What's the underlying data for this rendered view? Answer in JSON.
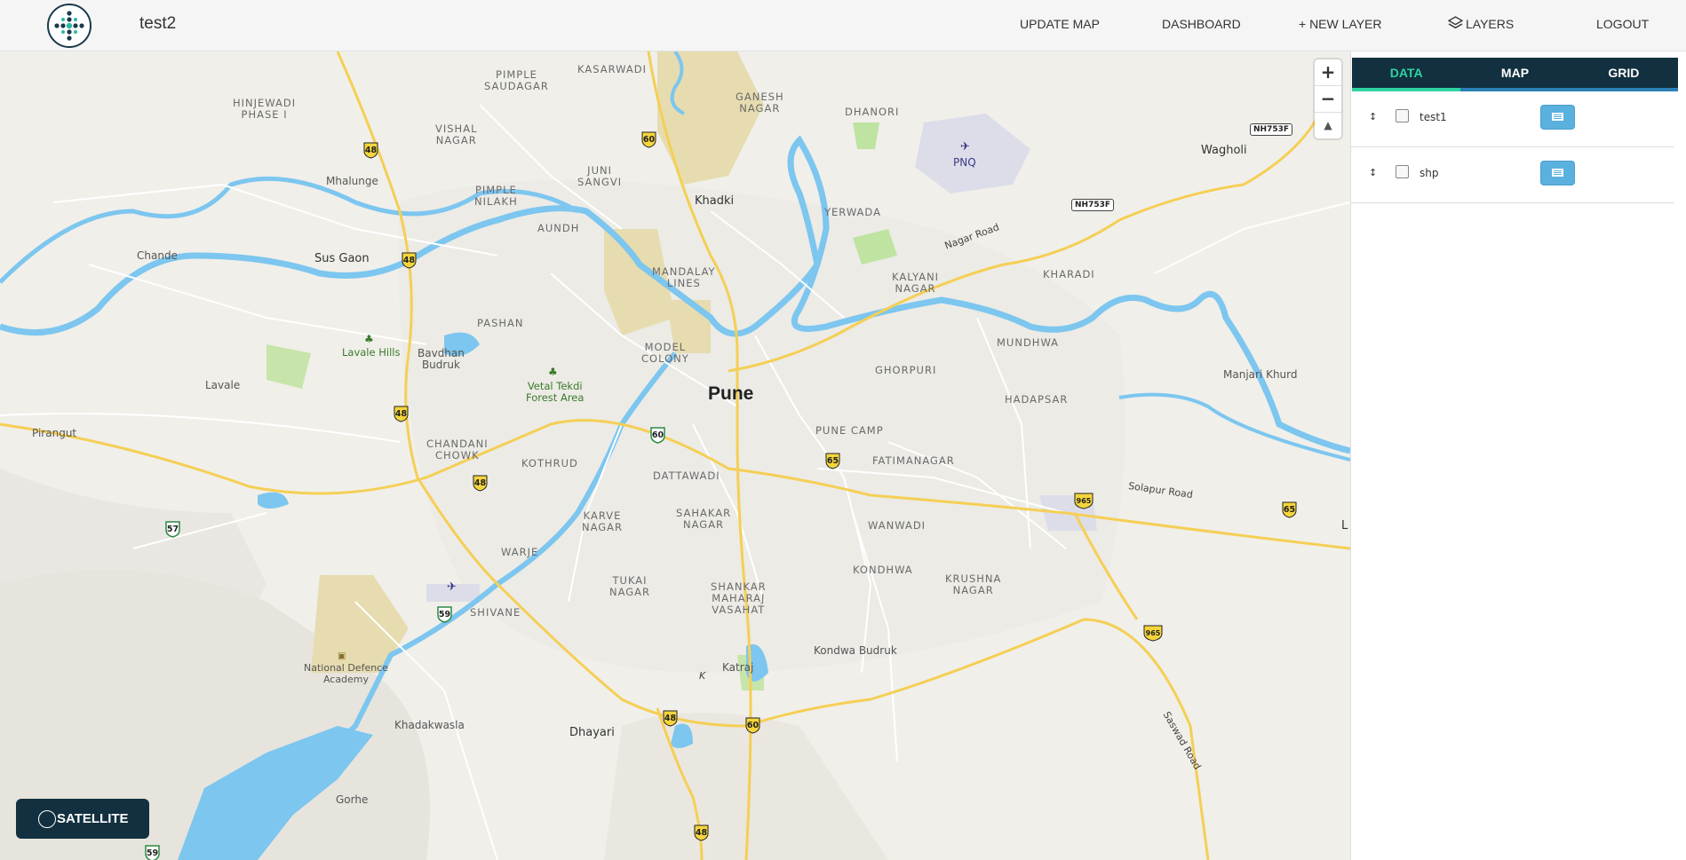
{
  "app": {
    "title": "test2"
  },
  "nav": {
    "update_map": "UPDATE MAP",
    "dashboard": "DASHBOARD",
    "new_layer": "+ NEW LAYER",
    "layers": "LAYERS",
    "logout": "LOGOUT"
  },
  "map": {
    "zoom_in": "+",
    "zoom_out": "−",
    "compass": "▲",
    "satellite_label": "SATELLITE",
    "city_label": "Pune",
    "labels": {
      "hinjewadi": "HINJEWADI\nPHASE I",
      "pimple_saudagar": "PIMPLE\nSAUDAGAR",
      "kasarwadi": "KASARWADI",
      "ganesh_nagar": "GANESH\nNAGAR",
      "dhanori": "DHANORI",
      "pnq": "PNQ",
      "wagholi": "Wagholi",
      "vishal_nagar": "VISHAL\nNAGAR",
      "mhalunge": "Mhalunge",
      "juni_sangvi": "JUNI\nSANGVI",
      "pimple_nilakh": "PIMPLE\nNILAKH",
      "khadki": "Khadki",
      "yerwada": "YERWADA",
      "aundh": "AUNDH",
      "chande": "Chande",
      "sus_gaon": "Sus Gaon",
      "mandalay_lines": "MANDALAY\nLINES",
      "nagar_road": "Nagar Road",
      "kalyani_nagar": "KALYANI\nNAGAR",
      "kharadi": "KHARADI",
      "pashan": "PASHAN",
      "lavale_hills": "Lavale Hills",
      "bavdhan": "Bavdhan\nBudruk",
      "model_colony": "MODEL\nCOLONY",
      "mundhwa": "MUNDHWA",
      "vetal_tekdi": "Vetal Tekdi\nForest Area",
      "ghorpuri": "GHORPURI",
      "manjari": "Manjari Khurd",
      "lavale": "Lavale",
      "hadapsar": "HADAPSAR",
      "pirangut": "Pirangut",
      "pune_camp": "PUNE CAMP",
      "chandani_chowk": "CHANDANI\nCHOWK",
      "kothrud": "KOTHRUD",
      "dattawadi": "DATTAWADI",
      "fatimanagar": "FATIMANAGAR",
      "solapur_road": "Solapur Road",
      "sahakar_nagar": "SAHAKAR\nNAGAR",
      "karve_nagar": "KARVE\nNAGAR",
      "wanwadi": "WANWADI",
      "warje": "WARJE",
      "tukai_nagar": "TUKAI\nNAGAR",
      "kondhwa": "KONDHWA",
      "krushna_nagar": "KRUSHNA\nNAGAR",
      "shankar": "SHANKAR\nMAHARAJ\nVASAHAT",
      "shivane": "SHIVANE",
      "nda": "National Defence\nAcademy",
      "saswad_road": "Saswad Road",
      "kondwa_budruk": "Kondwa Budruk",
      "katraj": "Katraj",
      "k": "K",
      "khadakwasla": "Khadakwasla",
      "dhayari": "Dhayari",
      "gorhe": "Gorhe",
      "edge_l": "L"
    },
    "shields": [
      "48",
      "60",
      "48",
      "48",
      "48",
      "60",
      "65",
      "965",
      "65",
      "965",
      "48",
      "60",
      "48",
      "57",
      "59",
      "59"
    ],
    "nh_badges": [
      "NH753F",
      "NH753F"
    ]
  },
  "panel": {
    "tabs": [
      "DATA",
      "MAP",
      "GRID"
    ],
    "active_tab": "DATA",
    "layers": [
      {
        "name": "test1",
        "drag": "↕"
      },
      {
        "name": "shp",
        "drag": "↕"
      }
    ]
  },
  "colors": {
    "water": "#7cc6ef",
    "major_road": "#f5cf55",
    "header_dark": "#12303f",
    "accent": "#2fd3a1"
  }
}
